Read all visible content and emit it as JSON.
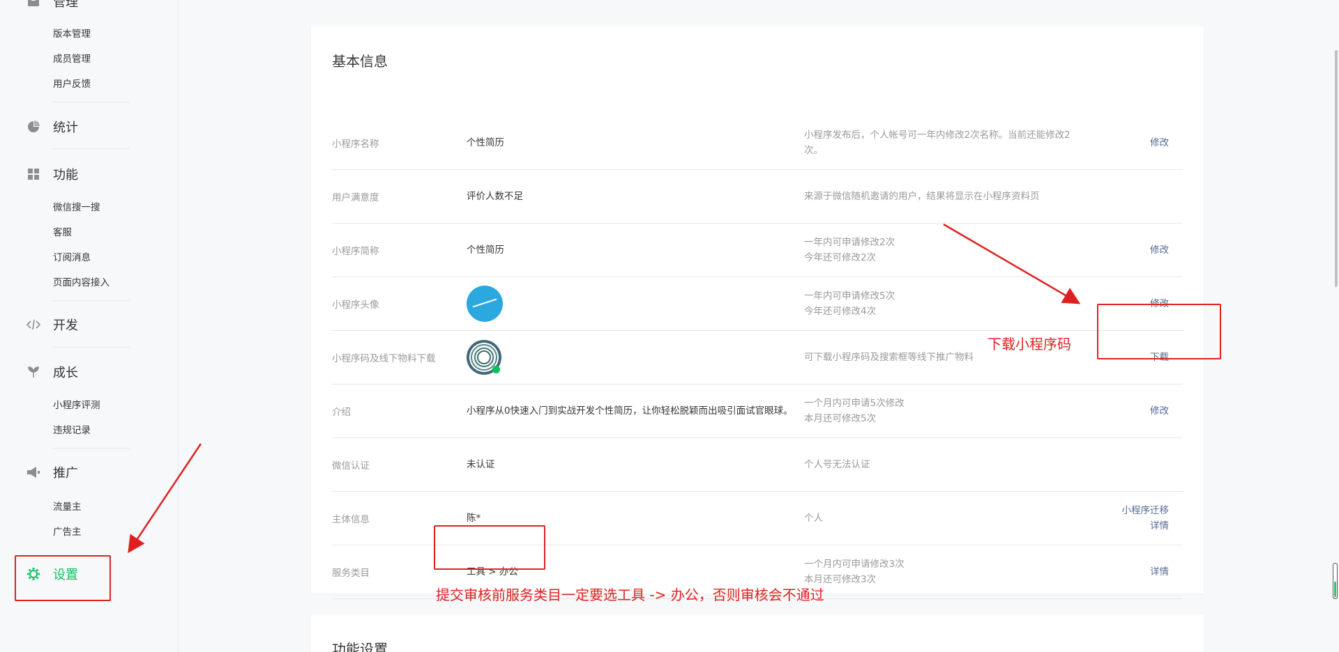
{
  "sidebar": {
    "manage": {
      "label": "管理",
      "icon": "box-icon",
      "items": [
        "版本管理",
        "成员管理",
        "用户反馈"
      ]
    },
    "stats": {
      "label": "统计",
      "icon": "pie-chart-icon"
    },
    "features": {
      "label": "功能",
      "icon": "grid-icon",
      "items": [
        "微信搜一搜",
        "客服",
        "订阅消息",
        "页面内容接入"
      ]
    },
    "dev": {
      "label": "开发",
      "icon": "code-icon"
    },
    "growth": {
      "label": "成长",
      "icon": "sprout-icon",
      "items": [
        "小程序评测",
        "违规记录"
      ]
    },
    "promo": {
      "label": "推广",
      "icon": "megaphone-icon",
      "items": [
        "流量主",
        "广告主"
      ]
    },
    "settings": {
      "label": "设置",
      "icon": "gear-icon",
      "active_color": "#07c160"
    }
  },
  "basic_info": {
    "title": "基本信息",
    "rows": [
      {
        "key": "小程序名称",
        "value": "个性简历",
        "desc": [
          "小程序发布后，个人帐号可一年内修改2次名称。当前还能修改2",
          "次。"
        ],
        "actions": [
          "修改"
        ]
      },
      {
        "key": "用户满意度",
        "value": "评价人数不足",
        "desc": [
          "来源于微信随机邀请的用户，结果将显示在小程序资料页"
        ],
        "actions": []
      },
      {
        "key": "小程序简称",
        "value": "个性简历",
        "desc": [
          "一年内可申请修改2次",
          "今年还可修改2次"
        ],
        "actions": [
          "修改"
        ]
      },
      {
        "key": "小程序头像",
        "value": "",
        "desc": [
          "一年内可申请修改5次",
          "今年还可修改4次"
        ],
        "actions": [
          "修改"
        ]
      },
      {
        "key": "小程序码及线下物料下载",
        "value": "",
        "desc": [
          "可下载小程序码及搜索框等线下推广物料"
        ],
        "actions": [
          "下载"
        ]
      },
      {
        "key": "介绍",
        "value": "小程序从0快速入门到实战开发个性简历，让你轻松脱颖而出吸引面试官眼球。",
        "desc": [
          "一个月内可申请5次修改",
          "本月还可修改5次"
        ],
        "actions": [
          "修改"
        ]
      },
      {
        "key": "微信认证",
        "value": "未认证",
        "desc": [
          "个人号无法认证"
        ],
        "actions": []
      },
      {
        "key": "主体信息",
        "value": "陈*",
        "desc": [
          "个人"
        ],
        "actions": [
          "小程序迁移",
          "详情"
        ]
      },
      {
        "key": "服务类目",
        "value": "工具 > 办公",
        "desc": [
          "一个月内可申请修改3次",
          "本月还可修改3次"
        ],
        "actions": [
          "详情"
        ]
      }
    ]
  },
  "feature_settings": {
    "title": "功能设置"
  },
  "annotations": {
    "download_note": "下载小程序码",
    "category_note": "提交审核前服务类目一定要选工具 -> 办公，否则审核会不通过",
    "color": "#e02020"
  }
}
